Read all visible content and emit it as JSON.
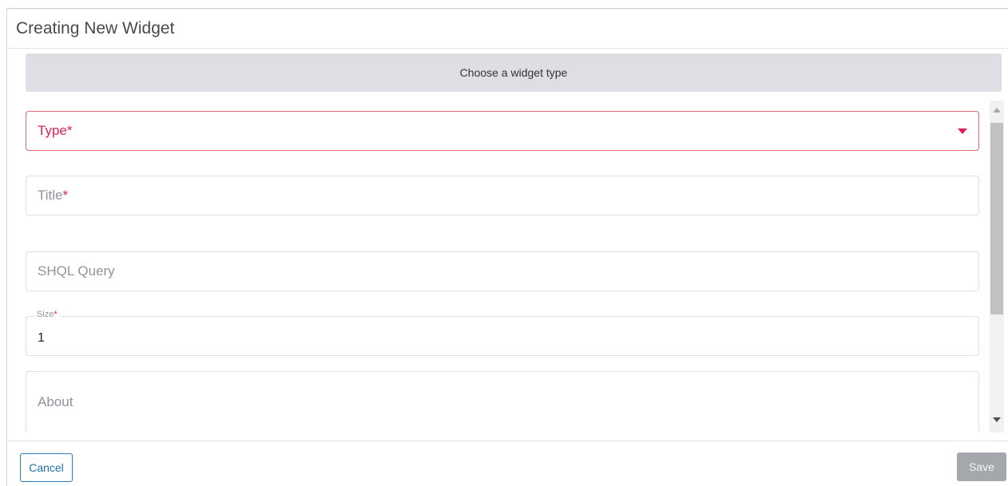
{
  "dialog": {
    "title": "Creating New Widget",
    "banner": "Choose a widget type"
  },
  "form": {
    "type": {
      "label": "Type",
      "required_mark": "*"
    },
    "title": {
      "label": "Title",
      "required_mark": "*"
    },
    "shql": {
      "label": "SHQL Query"
    },
    "size": {
      "label": "Size",
      "required_mark": "*",
      "value": "1"
    },
    "about": {
      "label": "About"
    }
  },
  "footer": {
    "cancel_label": "Cancel",
    "save_label": "Save"
  },
  "colors": {
    "required": "#e01e5a",
    "primary": "#1f6fae",
    "disabled": "#a4a7ab"
  },
  "icons": {
    "type_dropdown": "caret-down-icon",
    "scroll_up": "scroll-up-arrow-icon",
    "scroll_down": "scroll-down-arrow-icon"
  }
}
